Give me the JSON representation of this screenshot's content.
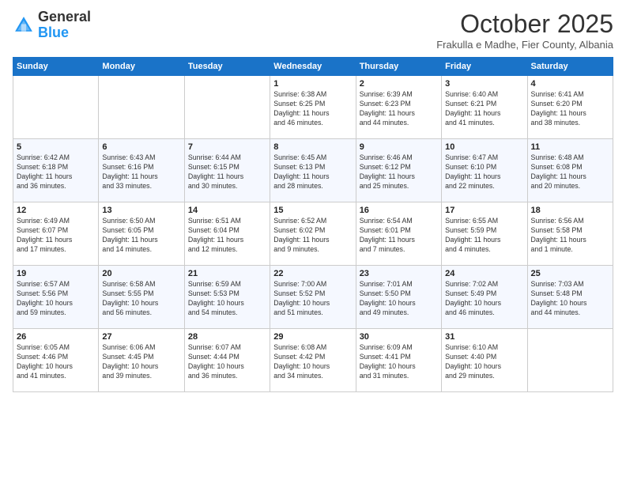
{
  "header": {
    "logo_general": "General",
    "logo_blue": "Blue",
    "month": "October 2025",
    "location": "Frakulla e Madhe, Fier County, Albania"
  },
  "weekdays": [
    "Sunday",
    "Monday",
    "Tuesday",
    "Wednesday",
    "Thursday",
    "Friday",
    "Saturday"
  ],
  "weeks": [
    [
      {
        "day": "",
        "info": ""
      },
      {
        "day": "",
        "info": ""
      },
      {
        "day": "",
        "info": ""
      },
      {
        "day": "1",
        "info": "Sunrise: 6:38 AM\nSunset: 6:25 PM\nDaylight: 11 hours\nand 46 minutes."
      },
      {
        "day": "2",
        "info": "Sunrise: 6:39 AM\nSunset: 6:23 PM\nDaylight: 11 hours\nand 44 minutes."
      },
      {
        "day": "3",
        "info": "Sunrise: 6:40 AM\nSunset: 6:21 PM\nDaylight: 11 hours\nand 41 minutes."
      },
      {
        "day": "4",
        "info": "Sunrise: 6:41 AM\nSunset: 6:20 PM\nDaylight: 11 hours\nand 38 minutes."
      }
    ],
    [
      {
        "day": "5",
        "info": "Sunrise: 6:42 AM\nSunset: 6:18 PM\nDaylight: 11 hours\nand 36 minutes."
      },
      {
        "day": "6",
        "info": "Sunrise: 6:43 AM\nSunset: 6:16 PM\nDaylight: 11 hours\nand 33 minutes."
      },
      {
        "day": "7",
        "info": "Sunrise: 6:44 AM\nSunset: 6:15 PM\nDaylight: 11 hours\nand 30 minutes."
      },
      {
        "day": "8",
        "info": "Sunrise: 6:45 AM\nSunset: 6:13 PM\nDaylight: 11 hours\nand 28 minutes."
      },
      {
        "day": "9",
        "info": "Sunrise: 6:46 AM\nSunset: 6:12 PM\nDaylight: 11 hours\nand 25 minutes."
      },
      {
        "day": "10",
        "info": "Sunrise: 6:47 AM\nSunset: 6:10 PM\nDaylight: 11 hours\nand 22 minutes."
      },
      {
        "day": "11",
        "info": "Sunrise: 6:48 AM\nSunset: 6:08 PM\nDaylight: 11 hours\nand 20 minutes."
      }
    ],
    [
      {
        "day": "12",
        "info": "Sunrise: 6:49 AM\nSunset: 6:07 PM\nDaylight: 11 hours\nand 17 minutes."
      },
      {
        "day": "13",
        "info": "Sunrise: 6:50 AM\nSunset: 6:05 PM\nDaylight: 11 hours\nand 14 minutes."
      },
      {
        "day": "14",
        "info": "Sunrise: 6:51 AM\nSunset: 6:04 PM\nDaylight: 11 hours\nand 12 minutes."
      },
      {
        "day": "15",
        "info": "Sunrise: 6:52 AM\nSunset: 6:02 PM\nDaylight: 11 hours\nand 9 minutes."
      },
      {
        "day": "16",
        "info": "Sunrise: 6:54 AM\nSunset: 6:01 PM\nDaylight: 11 hours\nand 7 minutes."
      },
      {
        "day": "17",
        "info": "Sunrise: 6:55 AM\nSunset: 5:59 PM\nDaylight: 11 hours\nand 4 minutes."
      },
      {
        "day": "18",
        "info": "Sunrise: 6:56 AM\nSunset: 5:58 PM\nDaylight: 11 hours\nand 1 minute."
      }
    ],
    [
      {
        "day": "19",
        "info": "Sunrise: 6:57 AM\nSunset: 5:56 PM\nDaylight: 10 hours\nand 59 minutes."
      },
      {
        "day": "20",
        "info": "Sunrise: 6:58 AM\nSunset: 5:55 PM\nDaylight: 10 hours\nand 56 minutes."
      },
      {
        "day": "21",
        "info": "Sunrise: 6:59 AM\nSunset: 5:53 PM\nDaylight: 10 hours\nand 54 minutes."
      },
      {
        "day": "22",
        "info": "Sunrise: 7:00 AM\nSunset: 5:52 PM\nDaylight: 10 hours\nand 51 minutes."
      },
      {
        "day": "23",
        "info": "Sunrise: 7:01 AM\nSunset: 5:50 PM\nDaylight: 10 hours\nand 49 minutes."
      },
      {
        "day": "24",
        "info": "Sunrise: 7:02 AM\nSunset: 5:49 PM\nDaylight: 10 hours\nand 46 minutes."
      },
      {
        "day": "25",
        "info": "Sunrise: 7:03 AM\nSunset: 5:48 PM\nDaylight: 10 hours\nand 44 minutes."
      }
    ],
    [
      {
        "day": "26",
        "info": "Sunrise: 6:05 AM\nSunset: 4:46 PM\nDaylight: 10 hours\nand 41 minutes."
      },
      {
        "day": "27",
        "info": "Sunrise: 6:06 AM\nSunset: 4:45 PM\nDaylight: 10 hours\nand 39 minutes."
      },
      {
        "day": "28",
        "info": "Sunrise: 6:07 AM\nSunset: 4:44 PM\nDaylight: 10 hours\nand 36 minutes."
      },
      {
        "day": "29",
        "info": "Sunrise: 6:08 AM\nSunset: 4:42 PM\nDaylight: 10 hours\nand 34 minutes."
      },
      {
        "day": "30",
        "info": "Sunrise: 6:09 AM\nSunset: 4:41 PM\nDaylight: 10 hours\nand 31 minutes."
      },
      {
        "day": "31",
        "info": "Sunrise: 6:10 AM\nSunset: 4:40 PM\nDaylight: 10 hours\nand 29 minutes."
      },
      {
        "day": "",
        "info": ""
      }
    ]
  ]
}
